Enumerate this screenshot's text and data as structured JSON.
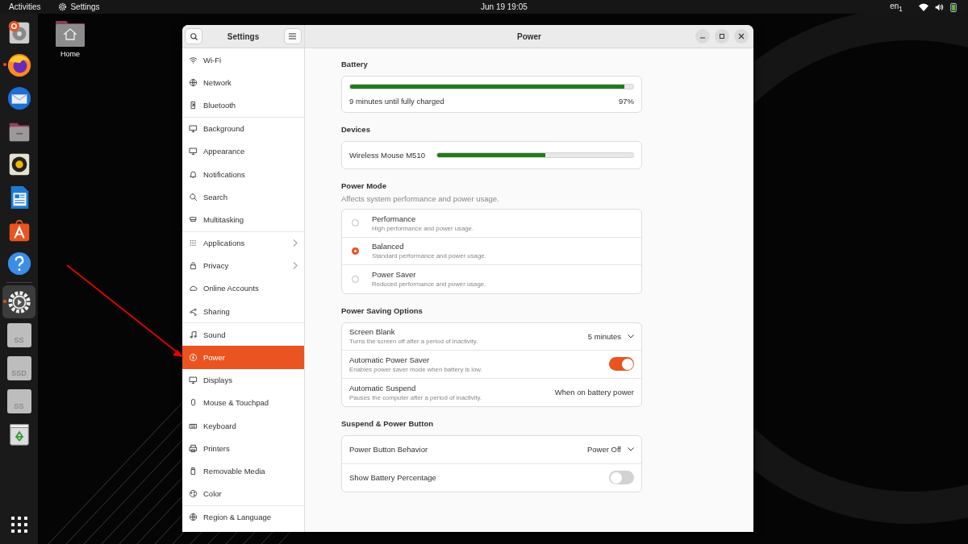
{
  "topbar": {
    "activities": "Activities",
    "app_name": "Settings",
    "clock": "Jun 19  19:05",
    "keyboard_layout": "en$_{1}$"
  },
  "dock": {
    "items": [
      {
        "kind": "installer",
        "running": false,
        "focused": false
      },
      {
        "kind": "browser",
        "running": true,
        "focused": false
      },
      {
        "kind": "mail",
        "running": false,
        "focused": false
      },
      {
        "kind": "files",
        "running": false,
        "focused": false
      },
      {
        "kind": "music",
        "running": false,
        "focused": false
      },
      {
        "kind": "writer",
        "running": false,
        "focused": false
      },
      {
        "kind": "store",
        "running": false,
        "focused": false
      },
      {
        "kind": "help",
        "running": false,
        "focused": false
      },
      {
        "kind": "settings",
        "running": true,
        "focused": true
      },
      {
        "kind": "drive",
        "label": "SS",
        "running": false,
        "focused": false
      },
      {
        "kind": "drive",
        "label": "SSD",
        "running": false,
        "focused": false
      },
      {
        "kind": "drive",
        "label": "SS",
        "running": false,
        "focused": false
      },
      {
        "kind": "trash",
        "running": false,
        "focused": false
      }
    ]
  },
  "desktop": {
    "icons": [
      {
        "label": "Home"
      }
    ]
  },
  "window": {
    "sidebar_title": "Settings",
    "title": "Power"
  },
  "sidebar": {
    "groups": [
      [
        {
          "label": "Wi-Fi",
          "selected": false,
          "submenu": false
        },
        {
          "label": "Network",
          "selected": false,
          "submenu": false
        },
        {
          "label": "Bluetooth",
          "selected": false,
          "submenu": false
        }
      ],
      [
        {
          "label": "Background",
          "selected": false,
          "submenu": false
        },
        {
          "label": "Appearance",
          "selected": false,
          "submenu": false
        },
        {
          "label": "Notifications",
          "selected": false,
          "submenu": false
        },
        {
          "label": "Search",
          "selected": false,
          "submenu": false
        },
        {
          "label": "Multitasking",
          "selected": false,
          "submenu": false
        }
      ],
      [
        {
          "label": "Applications",
          "selected": false,
          "submenu": true
        },
        {
          "label": "Privacy",
          "selected": false,
          "submenu": true
        },
        {
          "label": "Online Accounts",
          "selected": false,
          "submenu": false
        },
        {
          "label": "Sharing",
          "selected": false,
          "submenu": false
        }
      ],
      [
        {
          "label": "Sound",
          "selected": false,
          "submenu": false
        },
        {
          "label": "Power",
          "selected": true,
          "submenu": false
        },
        {
          "label": "Displays",
          "selected": false,
          "submenu": false
        },
        {
          "label": "Mouse & Touchpad",
          "selected": false,
          "submenu": false
        },
        {
          "label": "Keyboard",
          "selected": false,
          "submenu": false
        },
        {
          "label": "Printers",
          "selected": false,
          "submenu": false
        },
        {
          "label": "Removable Media",
          "selected": false,
          "submenu": false
        },
        {
          "label": "Color",
          "selected": false,
          "submenu": false
        }
      ],
      [
        {
          "label": "Region & Language",
          "selected": false,
          "submenu": false
        }
      ]
    ]
  },
  "battery": {
    "heading": "Battery",
    "level": 0.97,
    "status": "9 minutes until fully charged",
    "percent": "97%"
  },
  "devices": {
    "heading": "Devices",
    "items": [
      {
        "name": "Wireless Mouse M510",
        "level": 0.55
      }
    ]
  },
  "power_mode": {
    "heading": "Power Mode",
    "subtitle": "Affects system performance and power usage.",
    "options": [
      {
        "title": "Performance",
        "description": "High performance and power usage.",
        "selected": false
      },
      {
        "title": "Balanced",
        "description": "Standard performance and power usage.",
        "selected": true
      },
      {
        "title": "Power Saver",
        "description": "Reduced performance and power usage.",
        "selected": false
      }
    ]
  },
  "sections": [
    {
      "heading": "Power Saving Options",
      "rows": [
        {
          "kind": "dropdown",
          "title": "Screen Blank",
          "description": "Turns the screen off after a period of inactivity.",
          "value": "5 minutes"
        },
        {
          "kind": "switch",
          "title": "Automatic Power Saver",
          "description": "Enables power saver mode when battery is low.",
          "on": true
        },
        {
          "kind": "value",
          "title": "Automatic Suspend",
          "description": "Pauses the computer after a period of inactivity.",
          "value": "When on battery power"
        }
      ]
    },
    {
      "heading": "Suspend & Power Button",
      "rows": [
        {
          "kind": "dropdown",
          "title": "Power Button Behavior",
          "value": "Power Off"
        },
        {
          "kind": "switch",
          "title": "Show Battery Percentage",
          "on": false
        }
      ]
    }
  ]
}
